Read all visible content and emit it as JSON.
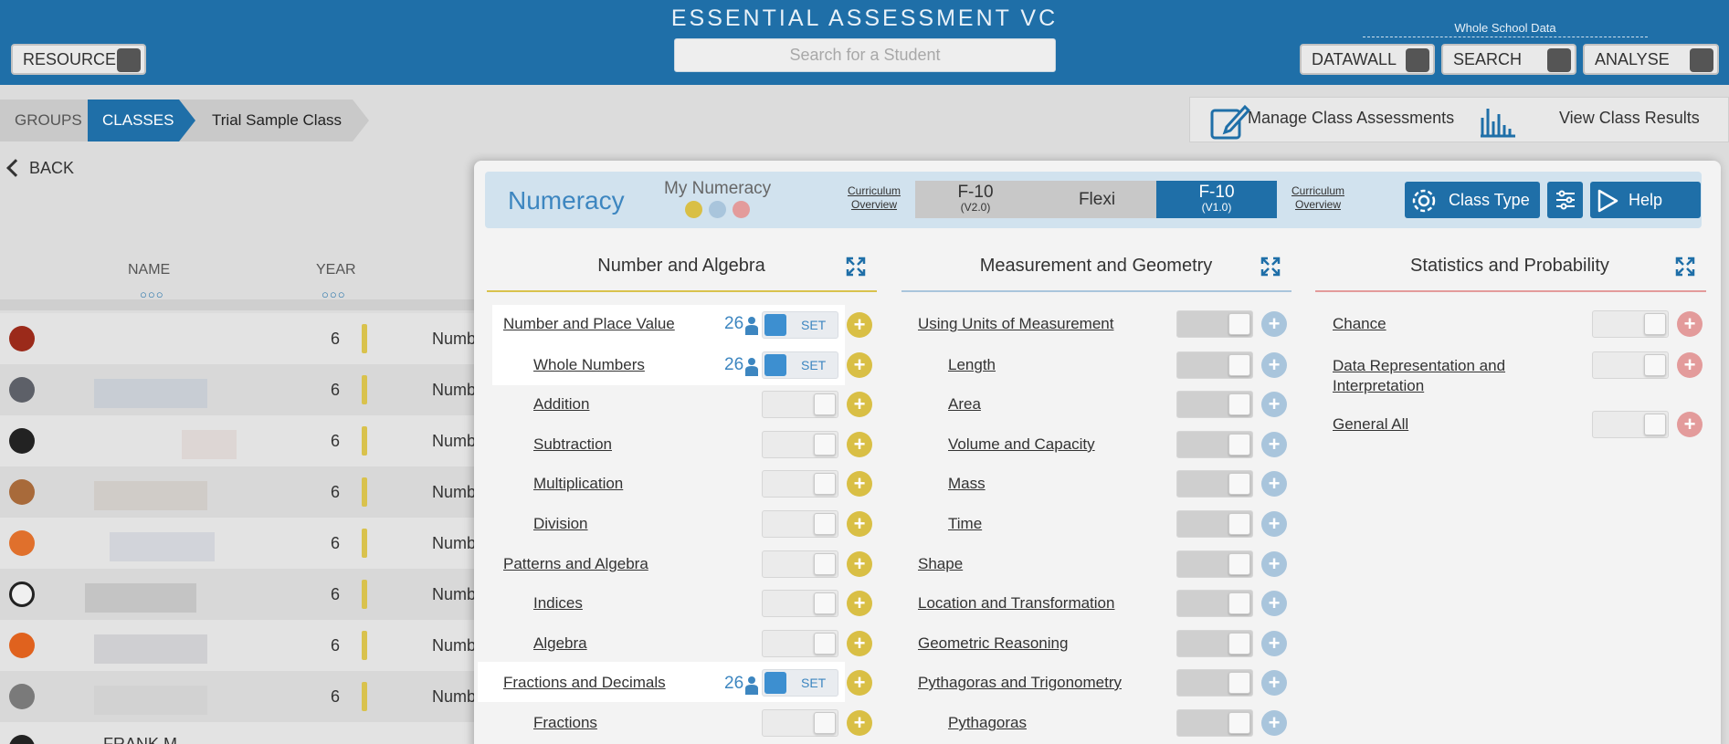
{
  "header": {
    "title": "ESSENTIAL ASSESSMENT VC",
    "search_placeholder": "Search for a Student",
    "resources_label": "RESOURCES",
    "whole_school_label": "Whole School Data",
    "datawall_label": "DATAWALL",
    "search_label": "SEARCH",
    "analyse_label": "ANALYSE"
  },
  "breadcrumb": {
    "groups": "GROUPS",
    "classes": "CLASSES",
    "current": "Trial Sample Class"
  },
  "back_label": "BACK",
  "actions": {
    "manage": "Manage Class Assessments",
    "view": "View Class Results"
  },
  "table": {
    "col_name": "NAME",
    "col_year": "YEAR",
    "rows": [
      {
        "year": "6",
        "subject": "Numb"
      },
      {
        "year": "6",
        "subject": "Numb"
      },
      {
        "year": "6",
        "subject": "Numb"
      },
      {
        "year": "6",
        "subject": "Numb"
      },
      {
        "year": "6",
        "subject": "Numb"
      },
      {
        "year": "6",
        "subject": "Numb"
      },
      {
        "year": "6",
        "subject": "Numb"
      },
      {
        "year": "6",
        "subject": "Numb"
      }
    ],
    "partial_name": "FRANK M"
  },
  "panel": {
    "title": "Numeracy",
    "my_numeracy": "My Numeracy",
    "curriculum_overview": "Curriculum Overview",
    "seg_f10_v2": "F-10",
    "seg_f10_v2_sub": "(V2.0)",
    "seg_flexi": "Flexi",
    "seg_f10_v1": "F-10",
    "seg_f10_v1_sub": "(V1.0)",
    "class_type": "Class Type",
    "help": "Help",
    "colors": {
      "accent": "#1f6fa8",
      "yellow": "#d9bf45",
      "blue": "#a9c5dc",
      "red": "#e39b9b"
    }
  },
  "columns": {
    "algebra": {
      "title": "Number and Algebra",
      "items": [
        {
          "label": "Number and Place Value",
          "count": "26",
          "set": "SET"
        },
        {
          "label": "Whole Numbers",
          "count": "26",
          "set": "SET"
        },
        {
          "label": "Addition"
        },
        {
          "label": "Subtraction"
        },
        {
          "label": "Multiplication"
        },
        {
          "label": "Division"
        },
        {
          "label": "Patterns and Algebra"
        },
        {
          "label": "Indices"
        },
        {
          "label": "Algebra"
        },
        {
          "label": "Fractions and Decimals",
          "count": "26",
          "set": "SET"
        },
        {
          "label": "Fractions"
        }
      ]
    },
    "geometry": {
      "title": "Measurement and Geometry",
      "items": [
        {
          "label": "Using Units of Measurement"
        },
        {
          "label": "Length"
        },
        {
          "label": "Area"
        },
        {
          "label": "Volume and Capacity"
        },
        {
          "label": "Mass"
        },
        {
          "label": "Time"
        },
        {
          "label": "Shape"
        },
        {
          "label": "Location and Transformation"
        },
        {
          "label": "Geometric Reasoning"
        },
        {
          "label": "Pythagoras and Trigonometry"
        },
        {
          "label": "Pythagoras"
        }
      ]
    },
    "stats": {
      "title": "Statistics and Probability",
      "items": [
        {
          "label": "Chance"
        },
        {
          "label": "Data Representation and Interpretation"
        },
        {
          "label": "General All"
        }
      ]
    }
  }
}
